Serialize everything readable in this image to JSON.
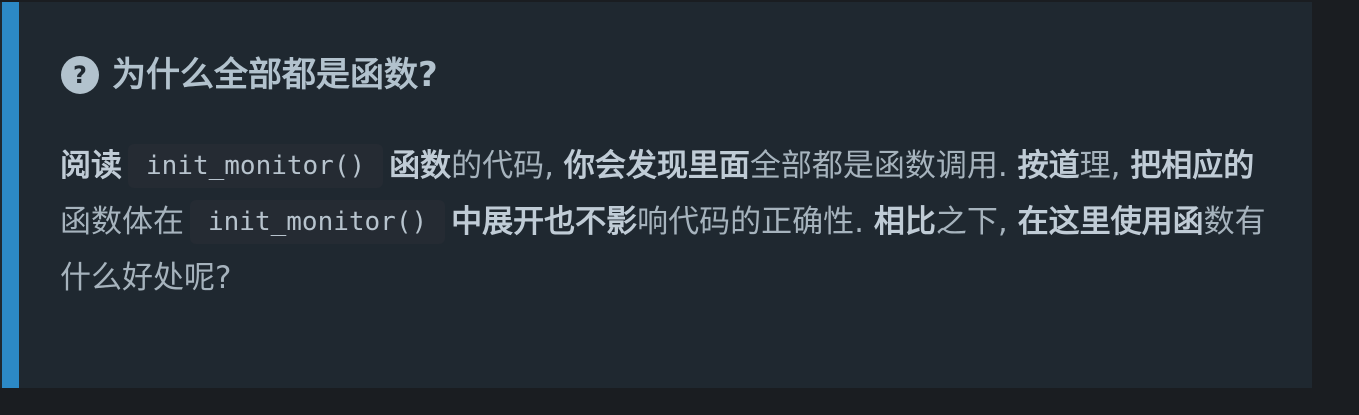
{
  "callout": {
    "title": "为什么全部都是函数?",
    "icon": "question-circle-icon",
    "accent_color": "#2c89c6",
    "segments": {
      "s1": "阅读",
      "code1": "init_monitor()",
      "s2": "函数",
      "s3": "的代码, ",
      "s4": "你会发现里面",
      "s5": "全部都是函数调用. ",
      "s6": "按道",
      "s7": "理, ",
      "s8": "把相应的",
      "s9": "函数体在",
      "code2": "init_monitor()",
      "s10": "中展开也不影",
      "s11": "响代码的正确性. ",
      "s12": "相比",
      "s13": "之下, ",
      "s14": "在这里使用函",
      "s15": "数有什么好处呢?"
    }
  }
}
